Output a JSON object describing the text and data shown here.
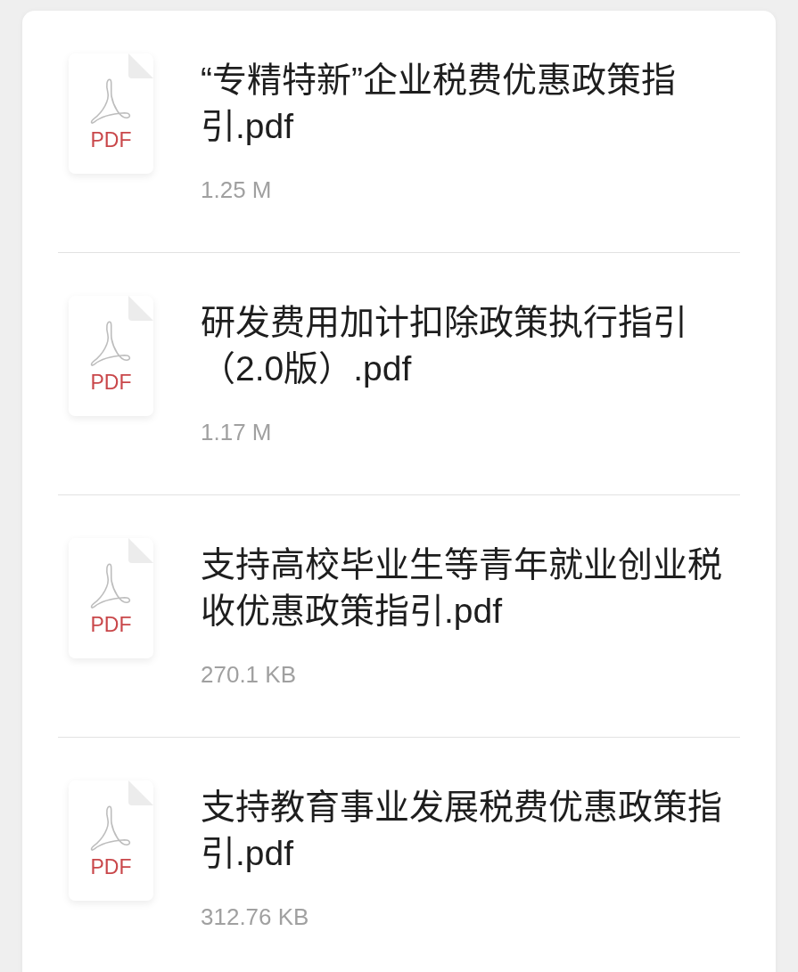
{
  "files": [
    {
      "name": "“专精特新”企业税费优惠政策指引.pdf",
      "size": "1.25 M",
      "icon_label": "PDF"
    },
    {
      "name": "研发费用加计扣除政策执行指引（2.0版）.pdf",
      "size": "1.17 M",
      "icon_label": "PDF"
    },
    {
      "name": "支持高校毕业生等青年就业创业税收优惠政策指引.pdf",
      "size": "270.1 KB",
      "icon_label": "PDF"
    },
    {
      "name": "支持教育事业发展税费优惠政策指引.pdf",
      "size": "312.76 KB",
      "icon_label": "PDF"
    }
  ]
}
